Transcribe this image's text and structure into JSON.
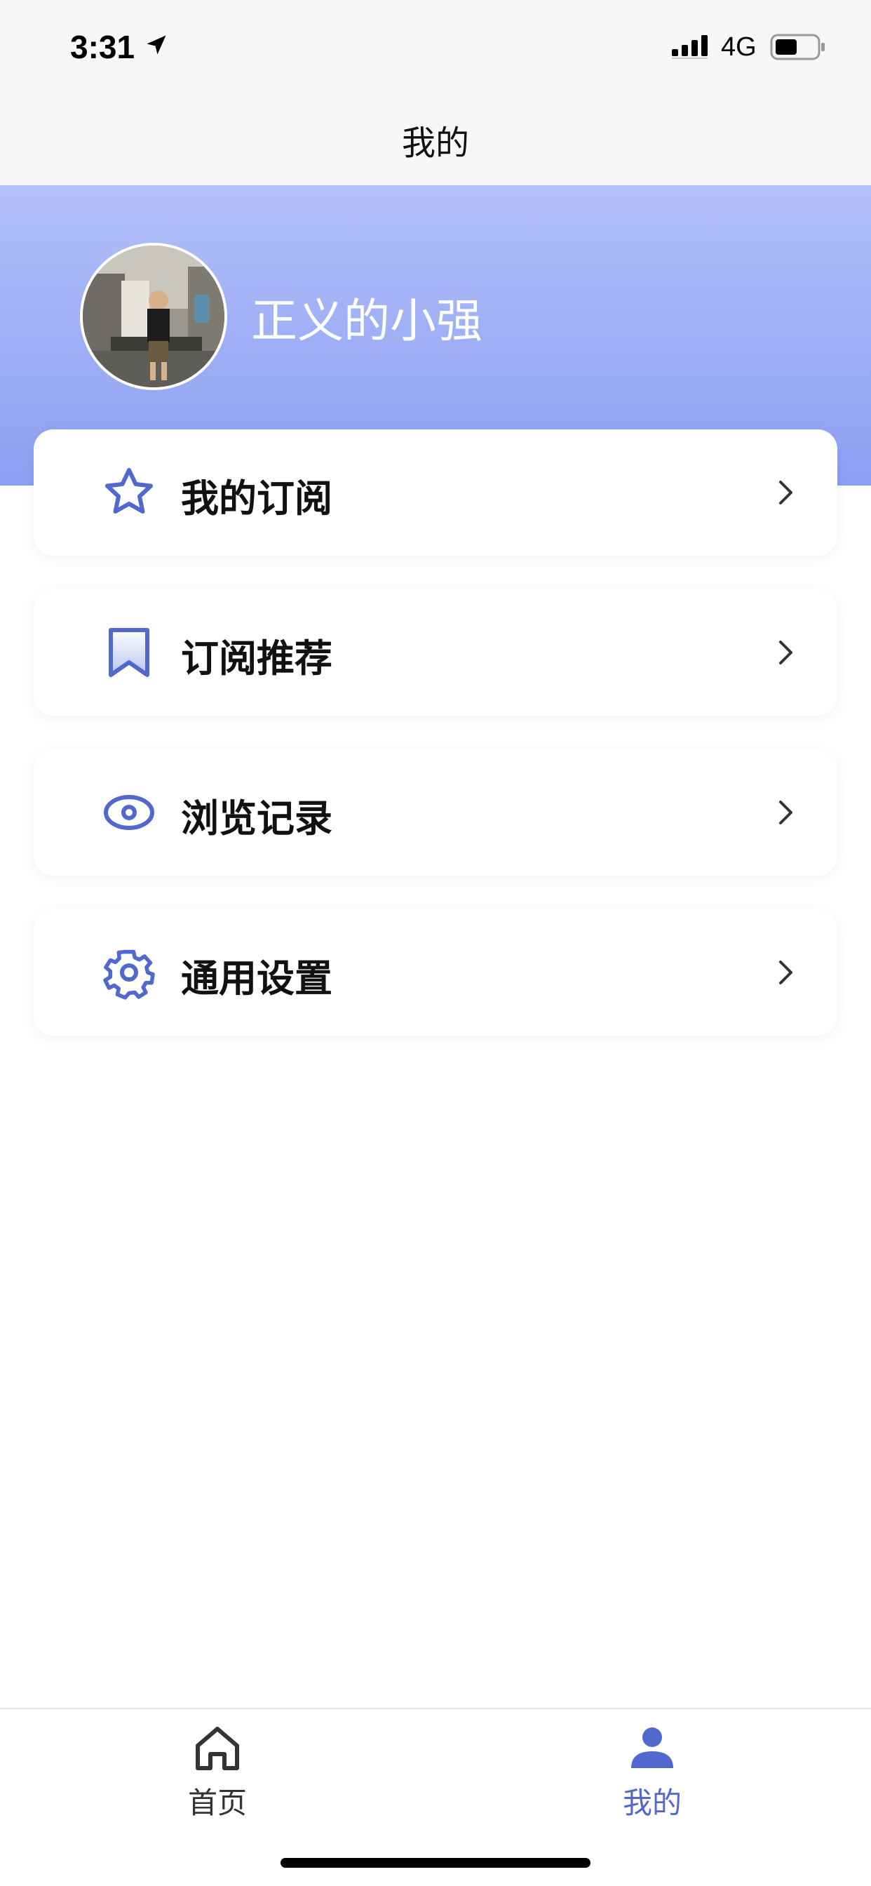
{
  "status_bar": {
    "time": "3:31",
    "network": "4G",
    "location_icon": "location-arrow-icon",
    "signal_icon": "signal-bars-icon",
    "battery_icon": "battery-icon"
  },
  "nav": {
    "title": "我的"
  },
  "profile": {
    "username": "正义的小强"
  },
  "menu": [
    {
      "label": "我的订阅",
      "icon": "star-icon"
    },
    {
      "label": "订阅推荐",
      "icon": "bookmark-icon"
    },
    {
      "label": "浏览记录",
      "icon": "eye-icon"
    },
    {
      "label": "通用设置",
      "icon": "gear-icon"
    }
  ],
  "tabs": [
    {
      "label": "首页",
      "icon": "home-icon",
      "active": false
    },
    {
      "label": "我的",
      "icon": "person-icon",
      "active": true
    }
  ],
  "colors": {
    "accent": "#5268cc",
    "header_top": "#b3c0fa",
    "header_bottom": "#8c9ff2",
    "tab_inactive": "#333333"
  }
}
